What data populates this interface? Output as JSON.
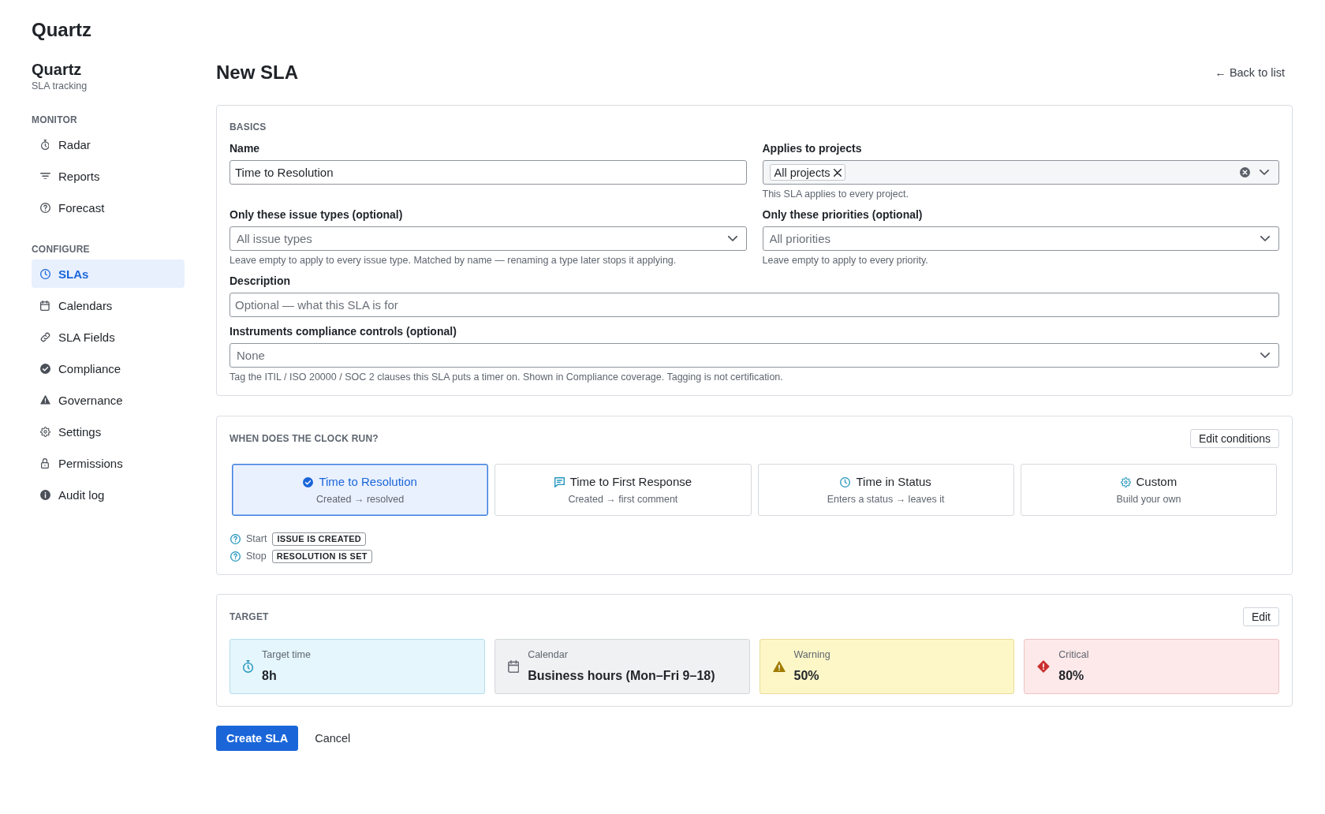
{
  "app": {
    "logo": "Quartz"
  },
  "sidebar": {
    "title": "Quartz",
    "subtitle": "SLA tracking",
    "sections": [
      {
        "heading": "MONITOR",
        "items": [
          {
            "label": "Radar",
            "selected": false
          },
          {
            "label": "Reports",
            "selected": false
          },
          {
            "label": "Forecast",
            "selected": false
          }
        ]
      },
      {
        "heading": "CONFIGURE",
        "items": [
          {
            "label": "SLAs",
            "selected": true
          },
          {
            "label": "Calendars",
            "selected": false
          },
          {
            "label": "SLA Fields",
            "selected": false
          },
          {
            "label": "Compliance",
            "selected": false
          },
          {
            "label": "Governance",
            "selected": false
          },
          {
            "label": "Settings",
            "selected": false
          },
          {
            "label": "Permissions",
            "selected": false
          },
          {
            "label": "Audit log",
            "selected": false
          }
        ]
      }
    ]
  },
  "page": {
    "title": "New SLA",
    "back_link": "← Back to list"
  },
  "basics": {
    "heading": "BASICS",
    "rows": [
      {
        "fields": [
          {
            "kind": "text",
            "label": "Name",
            "value": "Time to Resolution"
          },
          {
            "kind": "multiselect",
            "label": "Applies to projects",
            "tags": [
              "All projects"
            ],
            "help": "This SLA applies to every project."
          }
        ]
      },
      {
        "fields": [
          {
            "kind": "select",
            "label": "Only these issue types (optional)",
            "placeholder": "All issue types",
            "help": "Leave empty to apply to every issue type. Matched by name — renaming a type later stops it applying."
          },
          {
            "kind": "select",
            "label": "Only these priorities (optional)",
            "placeholder": "All priorities",
            "help": "Leave empty to apply to every priority."
          }
        ]
      },
      {
        "fields": [
          {
            "kind": "text",
            "label": "Description",
            "placeholder": "Optional — what this SLA is for"
          }
        ]
      },
      {
        "fields": [
          {
            "kind": "select",
            "label": "Instruments compliance controls (optional)",
            "placeholder": "None",
            "help": "Tag the ITIL / ISO 20000 / SOC 2 clauses this SLA puts a timer on. Shown in Compliance coverage. Tagging is not certification."
          }
        ]
      }
    ]
  },
  "clock": {
    "heading": "WHEN DOES THE CLOCK RUN?",
    "action": "Edit conditions",
    "options": [
      {
        "title": "Time to Resolution",
        "subtitle": "Created → resolved",
        "selected": true
      },
      {
        "title": "Time to First Response",
        "subtitle": "Created → first comment",
        "selected": false
      },
      {
        "title": "Time in Status",
        "subtitle": "Enters a status → leaves it",
        "selected": false
      },
      {
        "title": "Custom",
        "subtitle": "Build your own",
        "selected": false
      }
    ],
    "rules": [
      {
        "label": "Start",
        "value": "ISSUE IS CREATED"
      },
      {
        "label": "Stop",
        "value": "RESOLUTION IS SET"
      }
    ]
  },
  "target": {
    "heading": "TARGET",
    "action": "Edit",
    "tiles": [
      {
        "kind": "time",
        "label": "Target time",
        "value": "8h"
      },
      {
        "kind": "calendar",
        "label": "Calendar",
        "value": "Business hours (Mon–Fri 9–18)"
      },
      {
        "kind": "warning",
        "label": "Warning",
        "value": "50%"
      },
      {
        "kind": "critical",
        "label": "Critical",
        "value": "80%"
      }
    ]
  },
  "actions": [
    {
      "kind": "primary",
      "label": "Create SLA"
    },
    {
      "kind": "secondary",
      "label": "Cancel"
    }
  ]
}
